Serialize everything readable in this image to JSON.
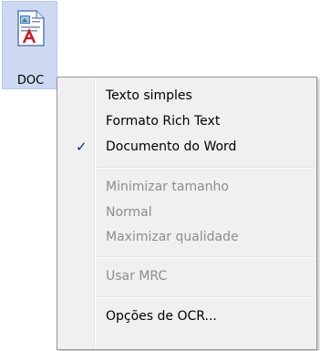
{
  "doc_button": {
    "label": "DOC",
    "icon": "word-document-icon"
  },
  "menu": {
    "items": [
      {
        "label": "Texto simples",
        "enabled": true,
        "checked": false
      },
      {
        "label": "Formato Rich Text",
        "enabled": true,
        "checked": false
      },
      {
        "label": "Documento do Word",
        "enabled": true,
        "checked": true
      },
      {
        "label": "Minimizar tamanho",
        "enabled": false,
        "checked": false
      },
      {
        "label": "Normal",
        "enabled": false,
        "checked": false
      },
      {
        "label": "Maximizar qualidade",
        "enabled": false,
        "checked": false
      },
      {
        "label": "Usar MRC",
        "enabled": false,
        "checked": false
      },
      {
        "label": "Opções de OCR...",
        "enabled": true,
        "checked": false
      }
    ],
    "check_glyph": "✓"
  }
}
